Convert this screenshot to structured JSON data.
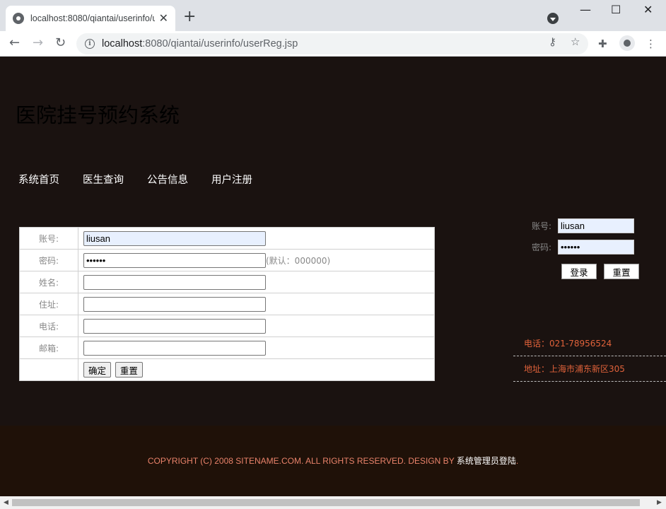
{
  "browser": {
    "tab_title": "localhost:8080/qiantai/userinfo/userReg.jsp",
    "tab_close": "✕",
    "new_tab": "+",
    "url_host": "localhost",
    "url_rest": ":8080/qiantai/userinfo/userReg.jsp",
    "win_min": "—",
    "win_max": "☐",
    "win_close": "✕"
  },
  "site": {
    "title": "医院挂号预约系统",
    "nav": [
      "系统首页",
      "医生查询",
      "公告信息",
      "用户注册"
    ]
  },
  "reg_form": {
    "account_label": "账号:",
    "account_value": "liusan",
    "password_label": "密码:",
    "password_value": "••••••",
    "password_hint": "(默认：000000)",
    "name_label": "姓名:",
    "address_label": "住址:",
    "phone_label": "电话:",
    "email_label": "邮箱:",
    "confirm_button": "确定",
    "reset_button": "重置"
  },
  "side_login": {
    "account_label": "账号:",
    "account_value": "liusan",
    "password_label": "密码:",
    "password_value": "••••••",
    "login_button": "登录",
    "reset_button": "重置"
  },
  "contact": {
    "phone": "电话：021-78956524",
    "address": "地址：上海市浦东新区305"
  },
  "footer": {
    "copyright": "COPYRIGHT (C) 2008 SITENAME.COM. ALL RIGHTS RESERVED. DESIGN BY ",
    "admin_link": "系统管理员登陆",
    "period": "."
  }
}
